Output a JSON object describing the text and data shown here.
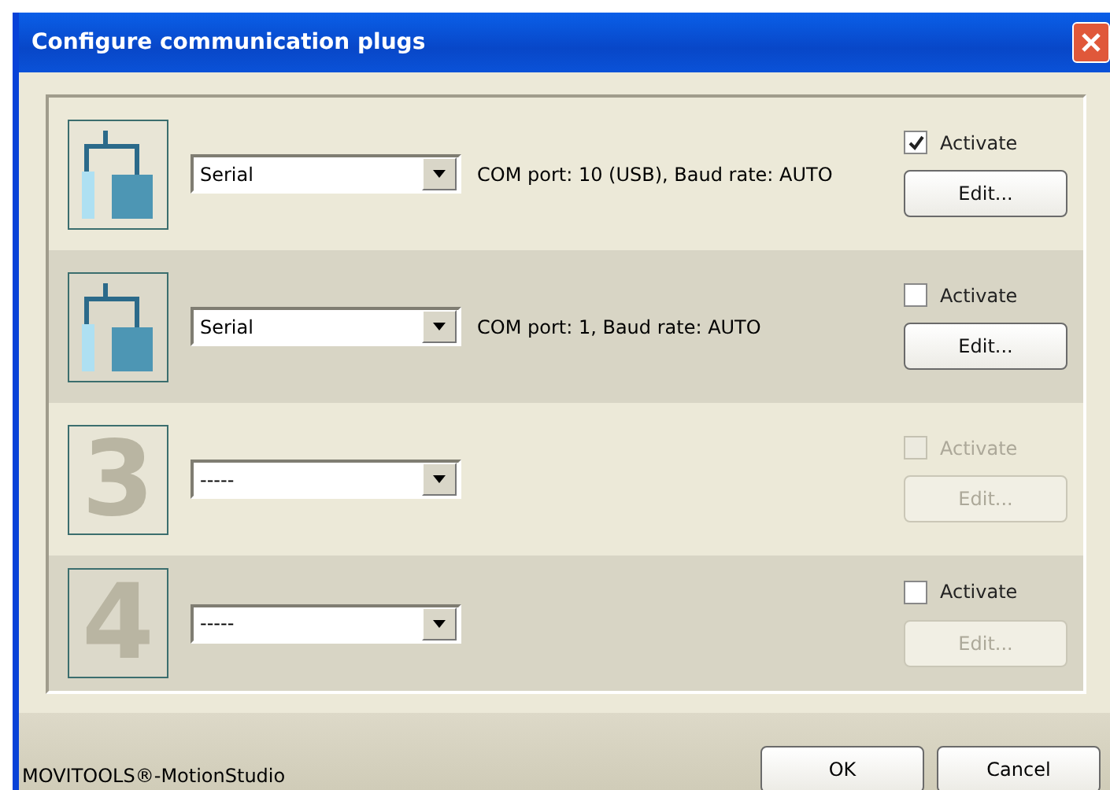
{
  "window": {
    "title": "Configure communication plugs"
  },
  "plugs": [
    {
      "kind": "plug",
      "type": "Serial",
      "info": "COM port: 10 (USB), Baud rate: AUTO",
      "activate": {
        "label": "Activate",
        "checked": true,
        "disabled": false
      },
      "edit": {
        "label": "Edit...",
        "disabled": false
      }
    },
    {
      "kind": "plug",
      "type": "Serial",
      "info": "COM port: 1, Baud rate: AUTO",
      "activate": {
        "label": "Activate",
        "checked": false,
        "disabled": false
      },
      "edit": {
        "label": "Edit...",
        "disabled": false
      }
    },
    {
      "kind": "empty",
      "number": "3",
      "type": "-----",
      "activate": {
        "label": "Activate",
        "checked": false,
        "disabled": true
      },
      "edit": {
        "label": "Edit...",
        "disabled": true
      }
    },
    {
      "kind": "empty",
      "number": "4",
      "type": "-----",
      "activate": {
        "label": "Activate",
        "checked": false,
        "disabled": false
      },
      "edit": {
        "label": "Edit...",
        "disabled": true
      }
    }
  ],
  "status_bar": {
    "text": "MOVITOOLS®-MotionStudio"
  },
  "buttons": [
    {
      "label": "OK"
    },
    {
      "label": "Cancel"
    }
  ]
}
